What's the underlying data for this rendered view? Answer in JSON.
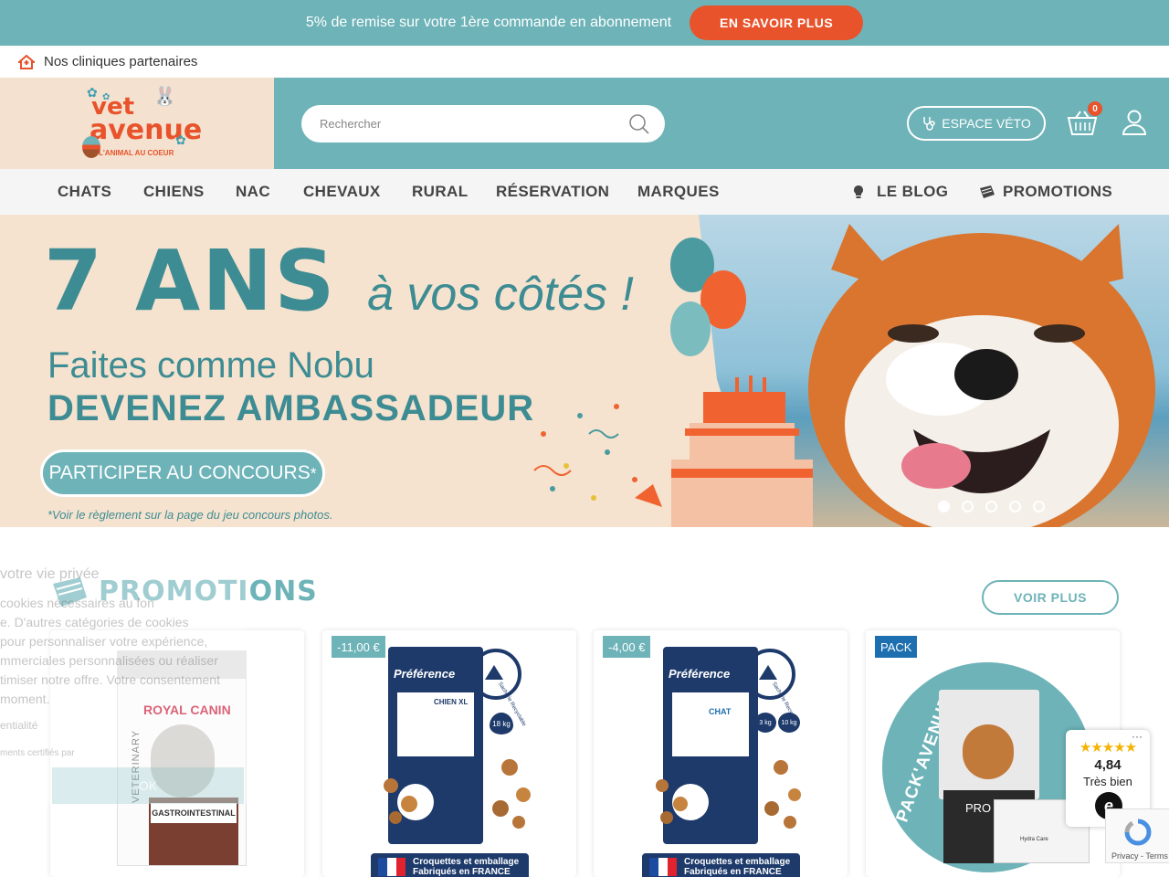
{
  "topbar": {
    "text": "5% de remise sur votre 1ère commande en abonnement",
    "button": "EN SAVOIR PLUS"
  },
  "clinics": {
    "label": "Nos cliniques partenaires",
    "icon": "home-icon"
  },
  "logo": {
    "line1": "vet",
    "line2": "avenue",
    "tagline": "L'ANIMAL AU COEUR"
  },
  "search": {
    "placeholder": "Rechercher",
    "value": ""
  },
  "header": {
    "espace_veto": "ESPACE VÉTO",
    "cart_count": "0"
  },
  "nav": {
    "items": [
      "CHATS",
      "CHIENS",
      "NAC",
      "CHEVAUX",
      "RURAL",
      "RÉSERVATION",
      "MARQUES"
    ],
    "blog": "LE BLOG",
    "promotions": "PROMOTIONS"
  },
  "hero": {
    "big": "7 ANS",
    "side": "à vos côtés !",
    "line1": "Faites comme Nobu",
    "line2": "DEVENEZ AMBASSADEUR",
    "button": "PARTICIPER AU CONCOURS",
    "button_mark": "*",
    "note": "*Voir le règlement sur la page du jeu concours photos.",
    "slides": 5,
    "active_slide": 1
  },
  "promotions": {
    "title": "PROMOTIONS",
    "more": "VOIR PLUS",
    "cards": [
      {
        "badge": "",
        "brand": "ROYAL CANIN",
        "sub": "VETERINARY",
        "product": "GASTROINTESTINAL"
      },
      {
        "badge": "-11,00 €",
        "brand": "Préférence",
        "product": "CHIEN XL",
        "weights": [
          "18 kg"
        ],
        "recycle": "Sacherie Recyclable",
        "footer1": "Croquettes et emballage",
        "footer2": "Fabriqués en FRANCE"
      },
      {
        "badge": "-4,00 €",
        "brand": "Préférence",
        "product": "CHAT",
        "weights": [
          "3 kg",
          "10 kg"
        ],
        "recycle": "Sacherie Recyclable",
        "footer1": "Croquettes et emballage",
        "footer2": "Fabriqués en FRANCE"
      },
      {
        "badge": "PACK",
        "pack": "PACK'AVENUE",
        "brand": "PRO PLAN",
        "sub": "Hydra Care"
      }
    ]
  },
  "cookie": {
    "title": "votre vie privée",
    "lines": [
      "cookies nécessaires au fon",
      "e. D'autres catégories de cookies",
      "pour personnaliser votre expérience,",
      "mmerciales personnalisées ou réaliser",
      "timiser notre offre. Votre consentement",
      "moment."
    ],
    "link": "entialité",
    "certified": "ments certifiés par",
    "button": "OK"
  },
  "trust": {
    "rating": "4,84",
    "label": "Très bien",
    "logo": "e"
  },
  "recaptcha": {
    "links": "Privacy - Terms"
  },
  "colors": {
    "teal": "#6db3b8",
    "orange": "#e8532c",
    "dark_teal": "#3e8c93"
  }
}
